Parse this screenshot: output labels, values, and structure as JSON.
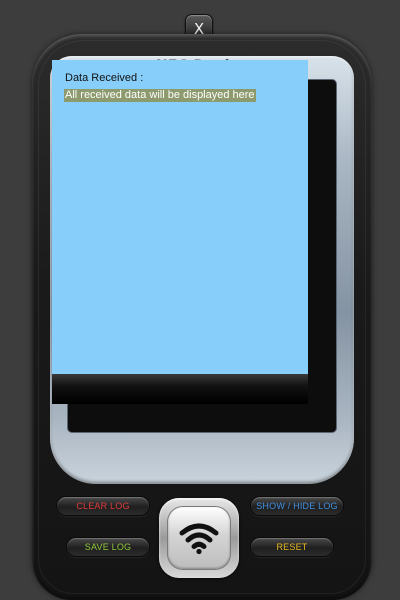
{
  "window": {
    "close_label": "X"
  },
  "device": {
    "title": "NFC Device"
  },
  "screen": {
    "label": "Data Received :",
    "message": "All received data will be displayed here"
  },
  "buttons": {
    "clear_log": "CLEAR LOG",
    "show_hide_log": "SHOW / HIDE LOG",
    "save_log": "SAVE LOG",
    "reset": "RESET"
  },
  "icons": {
    "close": "close-icon",
    "nfc": "nfc-wifi-icon"
  },
  "colors": {
    "background": "#3d3d3d",
    "screen": "#87cefa",
    "clear_log": "#e23b3b",
    "show_hide_log": "#3f8fe0",
    "save_log": "#8ec73a",
    "reset": "#e6b820",
    "message_highlight": "#8c9a6e"
  }
}
